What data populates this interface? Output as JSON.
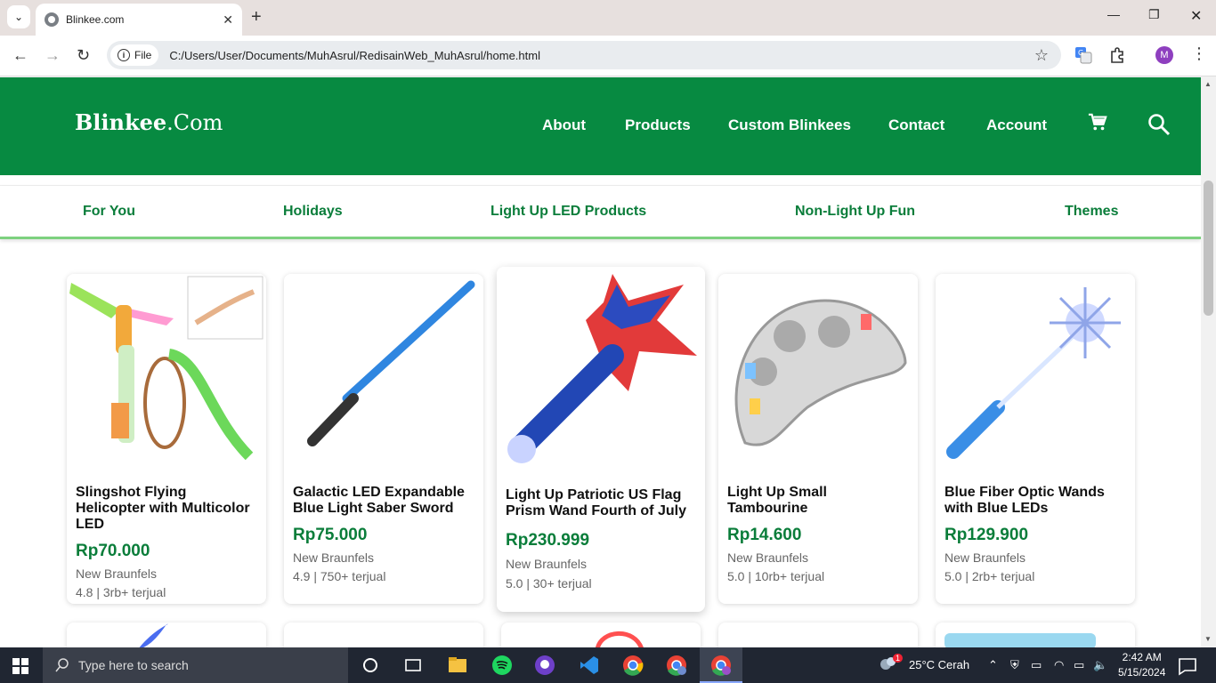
{
  "browser": {
    "tab_title": "Blinkee.com",
    "file_label": "File",
    "url": "C:/Users/User/Documents/MuhAsrul/RedisainWeb_MuhAsrul/home.html",
    "profile_initial": "M"
  },
  "site": {
    "logo_main": "Blinkee",
    "logo_suffix": ".Com",
    "nav": [
      "About",
      "Products",
      "Custom Blinkees",
      "Contact",
      "Account"
    ],
    "categories": [
      "For You",
      "Holidays",
      "Light Up LED Products",
      "Non-Light Up Fun",
      "Themes"
    ]
  },
  "products": [
    {
      "name": "Slingshot Flying Helicopter with Multicolor LED",
      "price": "Rp70.000",
      "location": "New Braunfels",
      "meta": "4.8 | 3rb+ terjual"
    },
    {
      "name": "Galactic LED Expandable Blue Light Saber Sword",
      "price": "Rp75.000",
      "location": "New Braunfels",
      "meta": "4.9 | 750+ terjual"
    },
    {
      "name": "Light Up Patriotic US Flag Prism Wand Fourth of July",
      "price": "Rp230.999",
      "location": "New Braunfels",
      "meta": "5.0 | 30+ terjual"
    },
    {
      "name": "Light Up Small Tambourine",
      "price": "Rp14.600",
      "location": "New Braunfels",
      "meta": "5.0 | 10rb+ terjual"
    },
    {
      "name": "Blue Fiber Optic Wands with Blue LEDs",
      "price": "Rp129.900",
      "location": "New Braunfels",
      "meta": "5.0 | 2rb+ terjual"
    }
  ],
  "taskbar": {
    "search_placeholder": "Type here to search",
    "weather": "25°C  Cerah",
    "weather_badge": "1",
    "time": "2:42 AM",
    "date": "5/15/2024"
  }
}
